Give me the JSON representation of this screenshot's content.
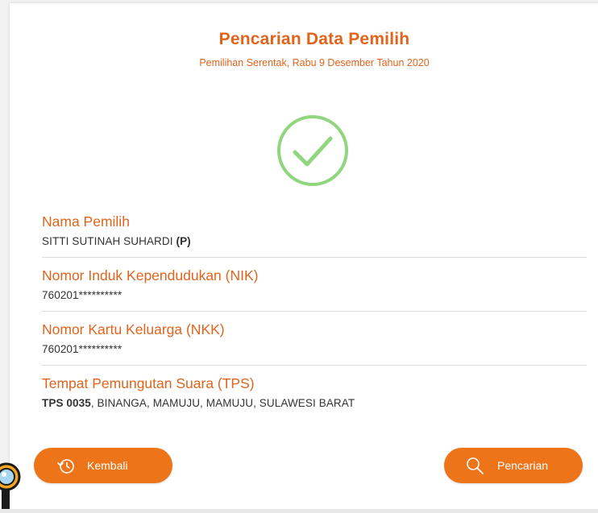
{
  "header": {
    "title": "Pencarian Data Pemilih",
    "subtitle": "Pemilihan Serentak, Rabu 9 Desember Tahun 2020"
  },
  "status_icon": "check-circle-icon",
  "fields": {
    "name": {
      "label": "Nama Pemilih",
      "value": "SITTI SUTINAH SUHARDI",
      "gender": "(P)"
    },
    "nik": {
      "label": "Nomor Induk Kependudukan (NIK)",
      "value": "760201**********"
    },
    "nkk": {
      "label": "Nomor Kartu Keluarga (NKK)",
      "value": "760201**********"
    },
    "tps": {
      "label": "Tempat Pemungutan Suara (TPS)",
      "tps_no": "TPS 0035",
      "location": ", BINANGA, MAMUJU, MAMUJU, SULAWESI BARAT"
    }
  },
  "buttons": {
    "back": {
      "label": "Kembali",
      "icon": "history-back-icon"
    },
    "search": {
      "label": "Pencarian",
      "icon": "search-icon"
    }
  },
  "colors": {
    "accent": "#e0641c",
    "button": "#ee7419",
    "check": "#8fd67f"
  }
}
